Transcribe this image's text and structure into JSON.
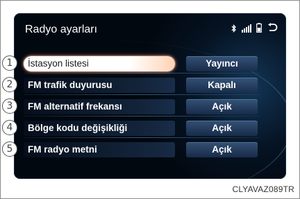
{
  "screen": {
    "title": "Radyo ayarları",
    "status_icons": [
      "bluetooth-icon",
      "signal-icon",
      "battery-icon",
      "back-arrow-icon"
    ]
  },
  "settings": {
    "items": [
      {
        "number": "1",
        "label": "İstasyon listesi",
        "value": "Yayıncı",
        "selected": true
      },
      {
        "number": "2",
        "label": "FM trafik duyurusu",
        "value": "Kapalı",
        "selected": false
      },
      {
        "number": "3",
        "label": "FM alternatif frekansı",
        "value": "Açık",
        "selected": false
      },
      {
        "number": "4",
        "label": "Bölge kodu değişikliği",
        "value": "Açık",
        "selected": false
      },
      {
        "number": "5",
        "label": "FM radyo metni",
        "value": "Açık",
        "selected": false
      }
    ]
  },
  "caption": {
    "code": "CLYAVAZ089TR"
  },
  "colors": {
    "screen_bg": "#020810",
    "selected_glow": "#ff8c5a",
    "value_bg": "#2d4a70"
  }
}
